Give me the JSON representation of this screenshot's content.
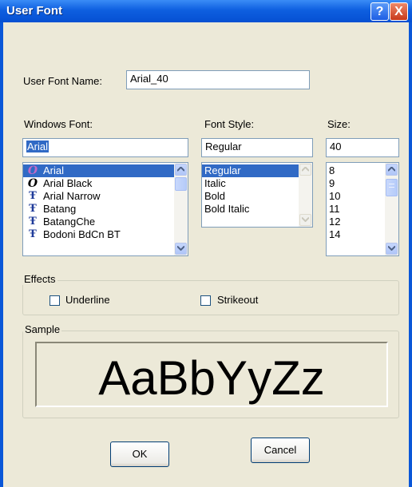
{
  "window": {
    "title": "User Font"
  },
  "titlebar_buttons": {
    "help": "?",
    "close": "X"
  },
  "user_font_name": {
    "label": "User Font Name:",
    "value": "Arial_40"
  },
  "windows_font": {
    "label": "Windows Font:",
    "value": "Arial",
    "items": [
      {
        "icon": "opentype-icon",
        "label": "Arial",
        "selected": true
      },
      {
        "icon": "opentype-icon",
        "label": "Arial Black"
      },
      {
        "icon": "truetype-icon",
        "label": "Arial Narrow"
      },
      {
        "icon": "truetype-icon",
        "label": "Batang"
      },
      {
        "icon": "truetype-icon",
        "label": "BatangChe"
      },
      {
        "icon": "truetype-icon",
        "label": "Bodoni BdCn BT"
      }
    ]
  },
  "font_style": {
    "label": "Font Style:",
    "value": "Regular",
    "items": [
      {
        "label": "Regular",
        "selected": true
      },
      {
        "label": "Italic"
      },
      {
        "label": "Bold"
      },
      {
        "label": "Bold Italic"
      }
    ]
  },
  "size": {
    "label": "Size:",
    "value": "40",
    "items": [
      {
        "label": "8"
      },
      {
        "label": "9"
      },
      {
        "label": "10"
      },
      {
        "label": "11"
      },
      {
        "label": "12"
      },
      {
        "label": "14"
      }
    ]
  },
  "effects": {
    "title": "Effects",
    "underline": "Underline",
    "strikeout": "Strikeout"
  },
  "sample": {
    "title": "Sample",
    "text": "AaBbYyZz"
  },
  "buttons": {
    "ok": "OK",
    "cancel": "Cancel"
  },
  "colors": {
    "titlebar": "#0e5fe0",
    "selection": "#316ac5",
    "dialog_bg": "#ece9d8"
  }
}
